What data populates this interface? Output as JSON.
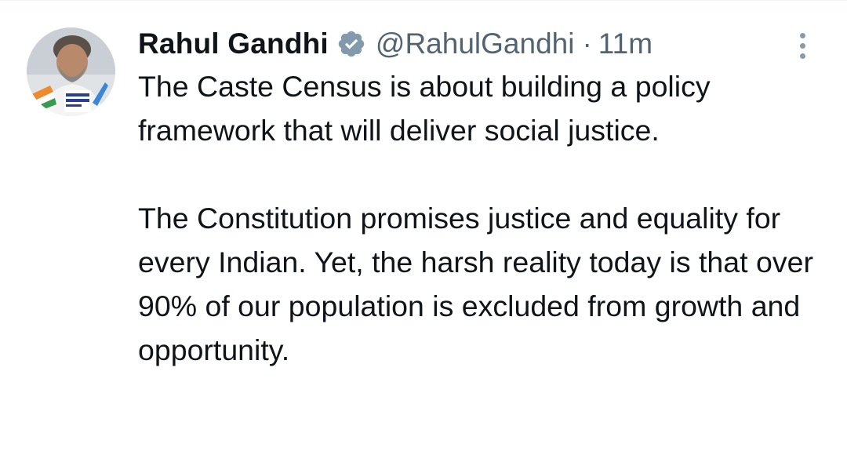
{
  "tweet": {
    "author": {
      "display_name": "Rahul Gandhi",
      "handle": "@RahulGandhi",
      "verified": true
    },
    "separator": "·",
    "time": "11m",
    "paragraphs": [
      "The Caste Census is about building a policy framework that will deliver social justice.",
      "The Constitution promises justice and equality for every Indian. Yet, the harsh reality today is that over 90% of our population is excluded from growth and opportunity."
    ]
  },
  "icons": {
    "verified": "verified-badge-icon",
    "more": "more-options-icon"
  },
  "colors": {
    "text_primary": "#0f1419",
    "text_secondary": "#536471",
    "verified_badge": "#829aab"
  }
}
